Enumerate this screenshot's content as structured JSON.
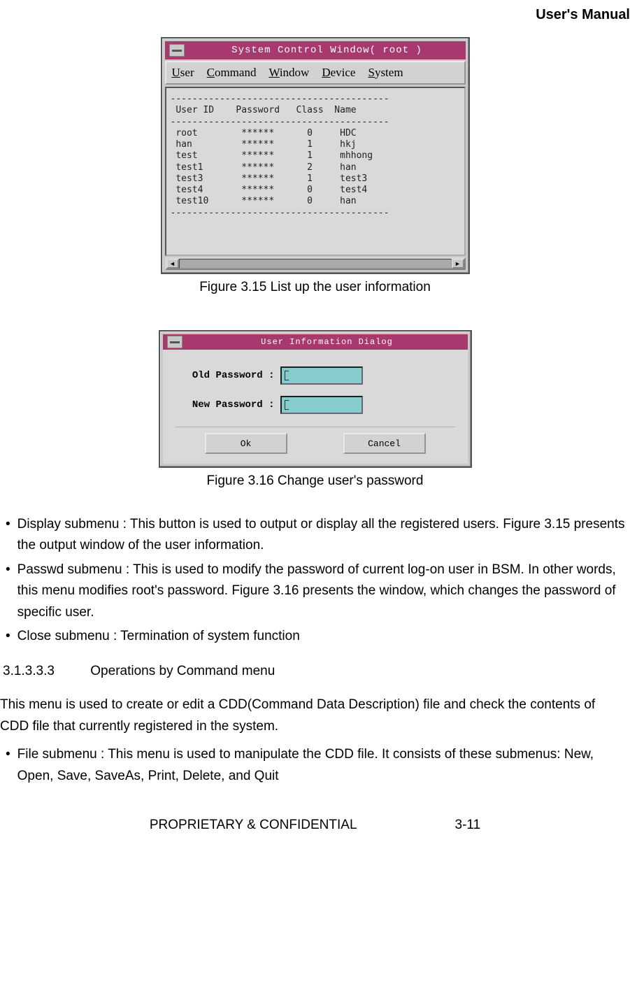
{
  "header": {
    "title": "User's Manual"
  },
  "figure1": {
    "caption": "Figure 3.15 List up the user information",
    "window_title": "System Control Window( root )",
    "menubar": {
      "user": "User",
      "command": "Command",
      "window": "Window",
      "device": "Device",
      "system": "System"
    },
    "table": {
      "divider": "----------------------------------------",
      "header": " User ID    Password   Class  Name",
      "rows": [
        " root        ******      0     HDC",
        " han         ******      1     hkj",
        " test        ******      1     mhhong",
        " test1       ******      2     han",
        " test3       ******      1     test3",
        " test4       ******      0     test4",
        " test10      ******      0     han"
      ]
    }
  },
  "figure2": {
    "caption": "Figure 3.16 Change user's password",
    "dialog_title": "User Information Dialog",
    "old_password_label": "Old Password :",
    "new_password_label": "New Password :",
    "ok_label": "Ok",
    "cancel_label": "Cancel"
  },
  "body": {
    "bullet1": "Display submenu :  This button is used to output or display all the registered users. Figure 3.15 presents the output window of the user information.",
    "bullet2": "Passwd submenu : This is used to modify the password of current log-on user in BSM. In other words, this menu modifies root's password. Figure 3.16 presents the window, which changes the password of specific user.",
    "bullet3": "Close submenu : Termination of system function",
    "section_num": "3.1.3.3.3",
    "section_title": "Operations by Command menu",
    "paragraph": "This menu is used to create or edit a CDD(Command Data Description) file and check the contents of CDD file that currently registered in the system.",
    "bullet4": "File submenu : This menu is used to manipulate the CDD file. It consists of these submenus: New, Open, Save, SaveAs, Print, Delete, and Quit"
  },
  "footer": {
    "left": "PROPRIETARY & CONFIDENTIAL",
    "right": "3-11"
  },
  "bullet_char": "•"
}
